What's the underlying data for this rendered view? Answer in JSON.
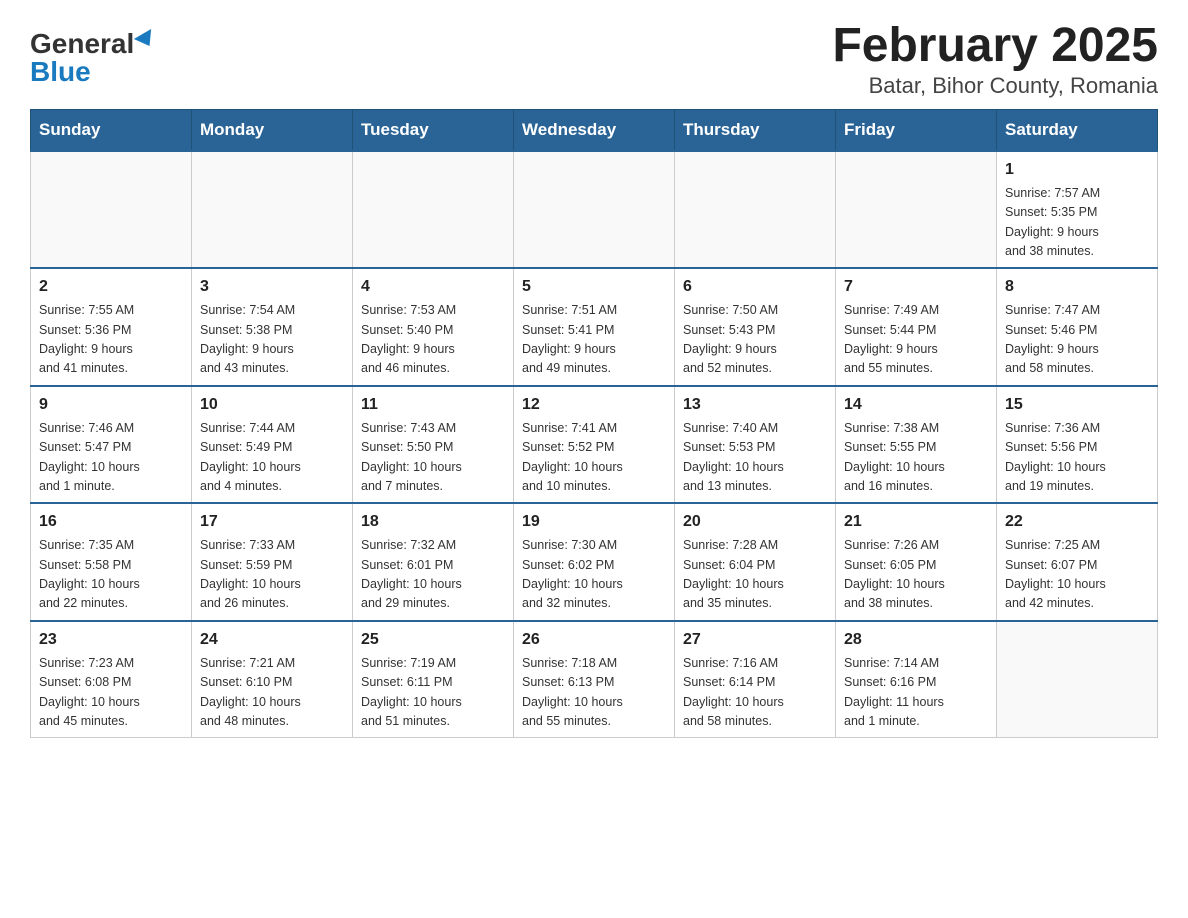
{
  "logo": {
    "general": "General",
    "blue": "Blue"
  },
  "title": "February 2025",
  "subtitle": "Batar, Bihor County, Romania",
  "days_of_week": [
    "Sunday",
    "Monday",
    "Tuesday",
    "Wednesday",
    "Thursday",
    "Friday",
    "Saturday"
  ],
  "weeks": [
    [
      {
        "day": "",
        "info": ""
      },
      {
        "day": "",
        "info": ""
      },
      {
        "day": "",
        "info": ""
      },
      {
        "day": "",
        "info": ""
      },
      {
        "day": "",
        "info": ""
      },
      {
        "day": "",
        "info": ""
      },
      {
        "day": "1",
        "info": "Sunrise: 7:57 AM\nSunset: 5:35 PM\nDaylight: 9 hours\nand 38 minutes."
      }
    ],
    [
      {
        "day": "2",
        "info": "Sunrise: 7:55 AM\nSunset: 5:36 PM\nDaylight: 9 hours\nand 41 minutes."
      },
      {
        "day": "3",
        "info": "Sunrise: 7:54 AM\nSunset: 5:38 PM\nDaylight: 9 hours\nand 43 minutes."
      },
      {
        "day": "4",
        "info": "Sunrise: 7:53 AM\nSunset: 5:40 PM\nDaylight: 9 hours\nand 46 minutes."
      },
      {
        "day": "5",
        "info": "Sunrise: 7:51 AM\nSunset: 5:41 PM\nDaylight: 9 hours\nand 49 minutes."
      },
      {
        "day": "6",
        "info": "Sunrise: 7:50 AM\nSunset: 5:43 PM\nDaylight: 9 hours\nand 52 minutes."
      },
      {
        "day": "7",
        "info": "Sunrise: 7:49 AM\nSunset: 5:44 PM\nDaylight: 9 hours\nand 55 minutes."
      },
      {
        "day": "8",
        "info": "Sunrise: 7:47 AM\nSunset: 5:46 PM\nDaylight: 9 hours\nand 58 minutes."
      }
    ],
    [
      {
        "day": "9",
        "info": "Sunrise: 7:46 AM\nSunset: 5:47 PM\nDaylight: 10 hours\nand 1 minute."
      },
      {
        "day": "10",
        "info": "Sunrise: 7:44 AM\nSunset: 5:49 PM\nDaylight: 10 hours\nand 4 minutes."
      },
      {
        "day": "11",
        "info": "Sunrise: 7:43 AM\nSunset: 5:50 PM\nDaylight: 10 hours\nand 7 minutes."
      },
      {
        "day": "12",
        "info": "Sunrise: 7:41 AM\nSunset: 5:52 PM\nDaylight: 10 hours\nand 10 minutes."
      },
      {
        "day": "13",
        "info": "Sunrise: 7:40 AM\nSunset: 5:53 PM\nDaylight: 10 hours\nand 13 minutes."
      },
      {
        "day": "14",
        "info": "Sunrise: 7:38 AM\nSunset: 5:55 PM\nDaylight: 10 hours\nand 16 minutes."
      },
      {
        "day": "15",
        "info": "Sunrise: 7:36 AM\nSunset: 5:56 PM\nDaylight: 10 hours\nand 19 minutes."
      }
    ],
    [
      {
        "day": "16",
        "info": "Sunrise: 7:35 AM\nSunset: 5:58 PM\nDaylight: 10 hours\nand 22 minutes."
      },
      {
        "day": "17",
        "info": "Sunrise: 7:33 AM\nSunset: 5:59 PM\nDaylight: 10 hours\nand 26 minutes."
      },
      {
        "day": "18",
        "info": "Sunrise: 7:32 AM\nSunset: 6:01 PM\nDaylight: 10 hours\nand 29 minutes."
      },
      {
        "day": "19",
        "info": "Sunrise: 7:30 AM\nSunset: 6:02 PM\nDaylight: 10 hours\nand 32 minutes."
      },
      {
        "day": "20",
        "info": "Sunrise: 7:28 AM\nSunset: 6:04 PM\nDaylight: 10 hours\nand 35 minutes."
      },
      {
        "day": "21",
        "info": "Sunrise: 7:26 AM\nSunset: 6:05 PM\nDaylight: 10 hours\nand 38 minutes."
      },
      {
        "day": "22",
        "info": "Sunrise: 7:25 AM\nSunset: 6:07 PM\nDaylight: 10 hours\nand 42 minutes."
      }
    ],
    [
      {
        "day": "23",
        "info": "Sunrise: 7:23 AM\nSunset: 6:08 PM\nDaylight: 10 hours\nand 45 minutes."
      },
      {
        "day": "24",
        "info": "Sunrise: 7:21 AM\nSunset: 6:10 PM\nDaylight: 10 hours\nand 48 minutes."
      },
      {
        "day": "25",
        "info": "Sunrise: 7:19 AM\nSunset: 6:11 PM\nDaylight: 10 hours\nand 51 minutes."
      },
      {
        "day": "26",
        "info": "Sunrise: 7:18 AM\nSunset: 6:13 PM\nDaylight: 10 hours\nand 55 minutes."
      },
      {
        "day": "27",
        "info": "Sunrise: 7:16 AM\nSunset: 6:14 PM\nDaylight: 10 hours\nand 58 minutes."
      },
      {
        "day": "28",
        "info": "Sunrise: 7:14 AM\nSunset: 6:16 PM\nDaylight: 11 hours\nand 1 minute."
      },
      {
        "day": "",
        "info": ""
      }
    ]
  ]
}
